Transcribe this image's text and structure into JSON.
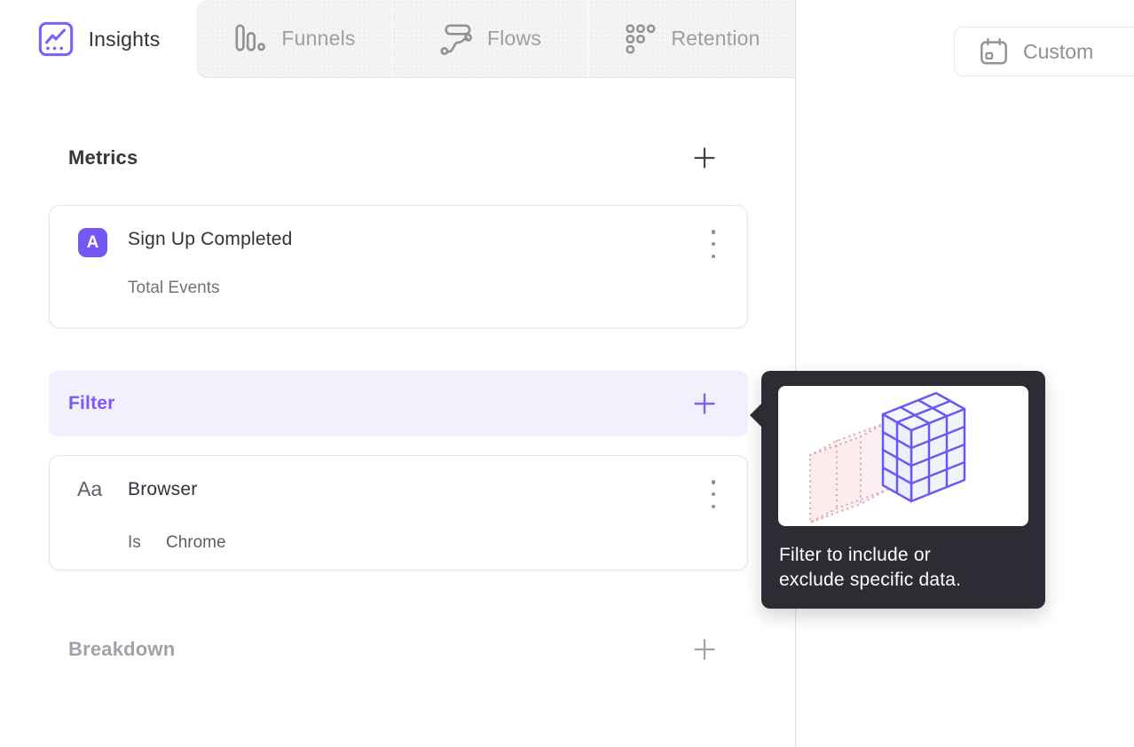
{
  "tabs": [
    {
      "label": "Insights",
      "icon": "insights-chart-icon",
      "active": true
    },
    {
      "label": "Funnels",
      "icon": "funnels-bars-icon",
      "active": false
    },
    {
      "label": "Flows",
      "icon": "flows-wave-icon",
      "active": false
    },
    {
      "label": "Retention",
      "icon": "retention-grid-icon",
      "active": false
    }
  ],
  "date_picker": {
    "label": "Custom",
    "icon": "calendar-icon"
  },
  "builder": {
    "metrics": {
      "title": "Metrics"
    },
    "metric_card": {
      "badge": "A",
      "title": "Sign Up Completed",
      "subtitle": "Total Events"
    },
    "filter": {
      "title": "Filter"
    },
    "filter_card": {
      "type_glyph": "Aa",
      "property": "Browser",
      "operator": "Is",
      "value": "Chrome"
    },
    "breakdown": {
      "title": "Breakdown"
    }
  },
  "tooltip": {
    "lines": [
      "Filter to include or",
      "exclude specific data."
    ],
    "illustration": "filter-cube-illustration"
  },
  "colors": {
    "accent_purple": "#7558F4",
    "filter_row_bg": "#F2F0FC",
    "filter_text": "#7C5AF7",
    "tooltip_bg": "#2C2D34",
    "illustration_purple": "#6A58F5",
    "illustration_pink": "#DFA3B0"
  }
}
